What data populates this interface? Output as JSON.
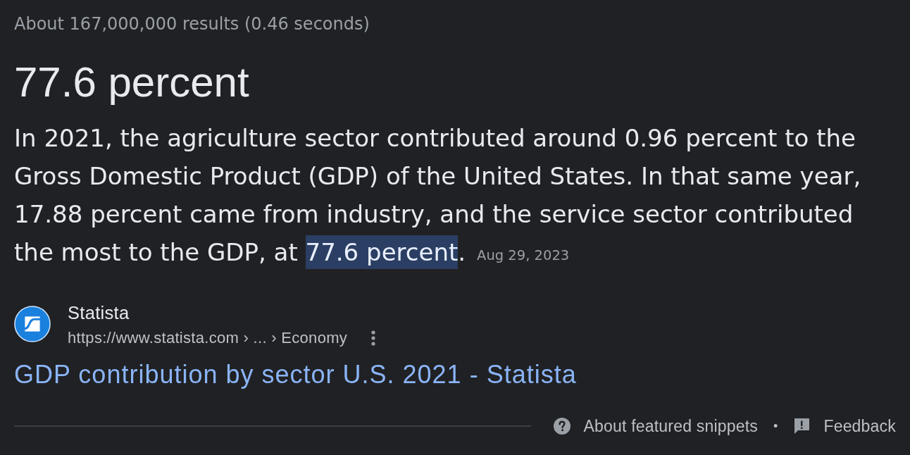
{
  "result_stats": "About 167,000,000 results (0.46 seconds)",
  "snippet": {
    "answer": "77.6 percent",
    "paragraph": [
      {
        "text": "In 2021, the agriculture sector contributed around 0.96 percent to the Gross Domestic Product (GDP) of the United States. In that same year, 17.88 percent came from industry, and the service sector contributed the most to the GDP, at ",
        "highlighted": false
      },
      {
        "text": "77.6 percent",
        "highlighted": true
      },
      {
        "text": ".",
        "highlighted": false
      }
    ],
    "date": "Aug 29, 2023"
  },
  "source": {
    "site_name": "Statista",
    "url": "https://www.statista.com › ... › Economy",
    "title": "GDP contribution by sector U.S. 2021 - Statista"
  },
  "footer": {
    "links": [
      {
        "kind": "help",
        "label": "About featured snippets"
      },
      {
        "kind": "feedback",
        "label": "Feedback"
      }
    ],
    "separator": "•"
  }
}
